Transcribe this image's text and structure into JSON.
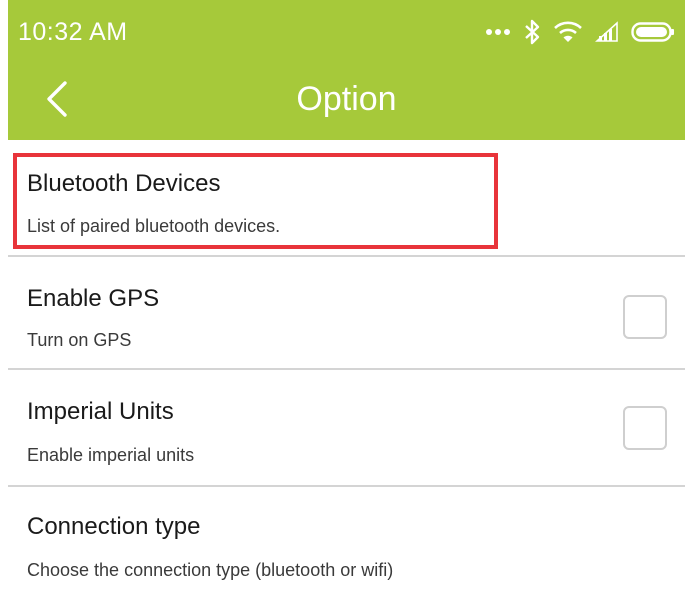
{
  "colors": {
    "accent": "#a6c93a",
    "highlight": "#e8343a"
  },
  "status_bar": {
    "time": "10:32 AM",
    "icons": [
      "more-dots-icon",
      "bluetooth-icon",
      "wifi-icon",
      "signal-icon",
      "battery-icon"
    ]
  },
  "app_bar": {
    "back_icon": "chevron-left-icon",
    "title": "Option"
  },
  "settings": [
    {
      "title": "Bluetooth Devices",
      "subtitle": "List of paired bluetooth devices.",
      "highlighted": true
    },
    {
      "title": "Enable GPS",
      "subtitle": "Turn on GPS",
      "checkbox": false
    },
    {
      "title": "Imperial Units",
      "subtitle": "Enable imperial units",
      "checkbox": false
    },
    {
      "title": "Connection type",
      "subtitle": "Choose the connection type (bluetooth or wifi)"
    }
  ]
}
